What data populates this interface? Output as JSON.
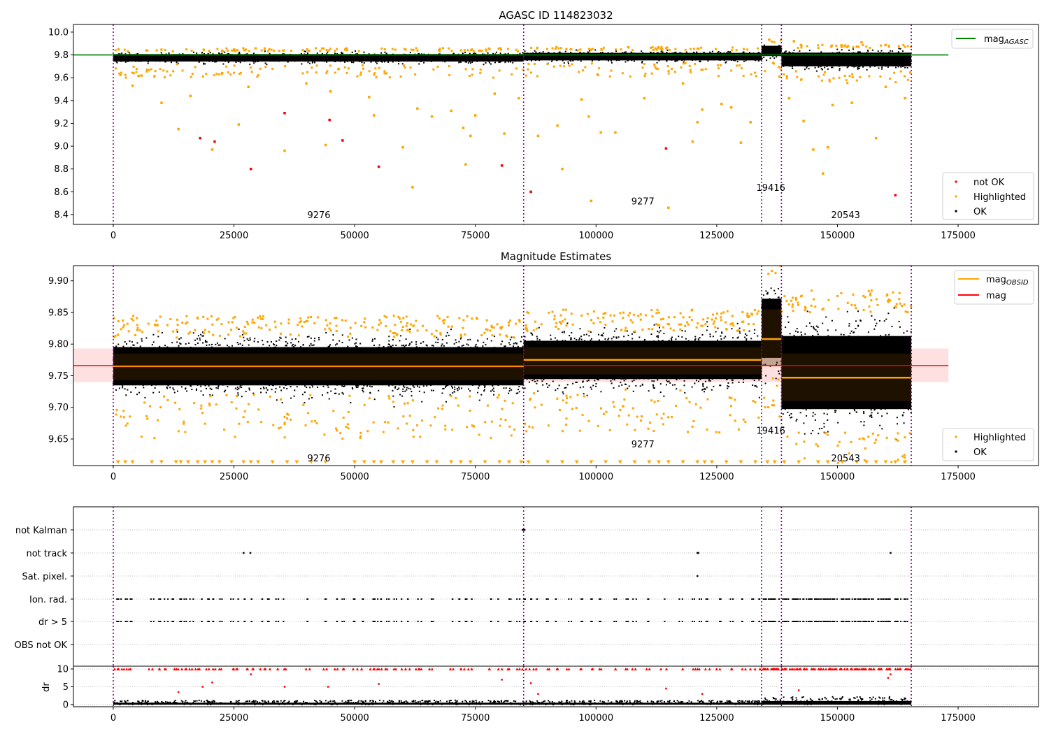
{
  "chart_data": [
    {
      "type": "scatter",
      "title": "AGASC ID 114823032",
      "xlim": [
        -8250,
        191650
      ],
      "ylim": [
        8.314,
        10.067
      ],
      "xticks": [
        0,
        25000,
        50000,
        75000,
        100000,
        125000,
        150000,
        175000
      ],
      "yticks": [
        8.4,
        8.6,
        8.8,
        9.0,
        9.2,
        9.4,
        9.6,
        9.8,
        10.0
      ],
      "ytick_labels": [
        "8.4",
        "8.6",
        "8.8",
        "9.0",
        "9.2",
        "9.4",
        "9.6",
        "9.8",
        "10.0"
      ],
      "mag_agasc": 9.8,
      "mag_agasc_xrange": [
        -8250,
        173000
      ],
      "legend_upper": [
        {
          "label": "mag",
          "sub": "AGASC",
          "color": "#008000"
        }
      ],
      "legend_lower": [
        {
          "label": "not OK",
          "color": "#ff0000"
        },
        {
          "label": "Highlighted",
          "color": "#ffa500"
        },
        {
          "label": "OK",
          "color": "#000000"
        }
      ],
      "obs_labels": [
        {
          "text": "9276",
          "x": 42600,
          "y": 8.4
        },
        {
          "text": "9277",
          "x": 109700,
          "y": 8.52
        },
        {
          "text": "19416",
          "x": 136200,
          "y": 8.64
        },
        {
          "text": "20543",
          "x": 151700,
          "y": 8.4
        }
      ],
      "ok_clouds": [
        {
          "x0": 0,
          "x1": 85000,
          "lo": 9.72,
          "hi": 9.83
        },
        {
          "x0": 85000,
          "x1": 134300,
          "lo": 9.73,
          "hi": 9.84
        },
        {
          "x0": 134300,
          "x1": 138400,
          "lo": 9.76,
          "hi": 9.91
        },
        {
          "x0": 138400,
          "x1": 165300,
          "lo": 9.66,
          "hi": 9.86
        }
      ],
      "not_ok": [
        [
          18000,
          9.07
        ],
        [
          21000,
          9.04
        ],
        [
          28500,
          8.8
        ],
        [
          35500,
          9.29
        ],
        [
          44800,
          9.23
        ],
        [
          47500,
          9.05
        ],
        [
          55000,
          8.82
        ],
        [
          80500,
          8.83
        ],
        [
          86500,
          8.6
        ],
        [
          114500,
          8.98
        ],
        [
          162000,
          8.57
        ]
      ],
      "highlighted": [
        [
          4000,
          9.53
        ],
        [
          10000,
          9.38
        ],
        [
          13500,
          9.15
        ],
        [
          16000,
          9.44
        ],
        [
          20500,
          8.97
        ],
        [
          26000,
          9.19
        ],
        [
          28000,
          9.52
        ],
        [
          35500,
          8.96
        ],
        [
          40000,
          9.55
        ],
        [
          44000,
          9.01
        ],
        [
          45000,
          9.48
        ],
        [
          53000,
          9.43
        ],
        [
          54000,
          9.27
        ],
        [
          60000,
          8.99
        ],
        [
          62000,
          8.64
        ],
        [
          63000,
          9.33
        ],
        [
          66000,
          9.26
        ],
        [
          70000,
          9.31
        ],
        [
          72500,
          9.16
        ],
        [
          73000,
          8.84
        ],
        [
          74000,
          9.09
        ],
        [
          75000,
          9.27
        ],
        [
          79000,
          9.46
        ],
        [
          81000,
          9.11
        ],
        [
          84000,
          9.42
        ],
        [
          88000,
          9.09
        ],
        [
          92000,
          9.18
        ],
        [
          93000,
          8.8
        ],
        [
          97000,
          9.41
        ],
        [
          98500,
          9.26
        ],
        [
          99000,
          8.52
        ],
        [
          101000,
          9.12
        ],
        [
          104000,
          9.12
        ],
        [
          110000,
          9.42
        ],
        [
          115000,
          8.46
        ],
        [
          118000,
          9.55
        ],
        [
          120000,
          9.04
        ],
        [
          121000,
          9.21
        ],
        [
          122000,
          9.32
        ],
        [
          126000,
          9.37
        ],
        [
          128000,
          9.34
        ],
        [
          130000,
          9.03
        ],
        [
          132000,
          9.21
        ],
        [
          138000,
          9.61
        ],
        [
          140000,
          9.42
        ],
        [
          143000,
          9.22
        ],
        [
          145000,
          8.97
        ],
        [
          147000,
          8.76
        ],
        [
          148000,
          8.99
        ],
        [
          149000,
          9.36
        ],
        [
          153000,
          9.38
        ],
        [
          158000,
          9.07
        ],
        [
          160000,
          9.52
        ],
        [
          164000,
          9.42
        ],
        [
          141000,
          9.92
        ],
        [
          155000,
          9.91
        ]
      ]
    },
    {
      "type": "scatter",
      "title": "Magnitude Estimates",
      "xlim": [
        -8250,
        191650
      ],
      "ylim": [
        9.608,
        9.924
      ],
      "xticks": [
        0,
        25000,
        50000,
        75000,
        100000,
        125000,
        150000,
        175000
      ],
      "yticks": [
        9.65,
        9.7,
        9.75,
        9.8,
        9.85,
        9.9
      ],
      "ytick_labels": [
        "9.65",
        "9.70",
        "9.75",
        "9.80",
        "9.85",
        "9.90"
      ],
      "mag": 9.766,
      "mag_band": [
        9.74,
        9.793
      ],
      "mag_xrange": [
        -8250,
        173000
      ],
      "legend_upper": [
        {
          "label": "mag",
          "sub": "OBSID",
          "color": "#ffa500"
        },
        {
          "label": "mag",
          "sub": "",
          "color": "#ff0000"
        }
      ],
      "legend_lower": [
        {
          "label": "Highlighted",
          "color": "#ffa500"
        },
        {
          "label": "OK",
          "color": "#000000"
        }
      ],
      "obs_labels": [
        {
          "text": "9276",
          "x": 42600,
          "y": 9.62
        },
        {
          "text": "9277",
          "x": 109700,
          "y": 9.642
        },
        {
          "text": "19416",
          "x": 136200,
          "y": 9.664
        },
        {
          "text": "20543",
          "x": 151700,
          "y": 9.62
        }
      ],
      "observations": [
        {
          "obsid": "9276",
          "x0": 0,
          "x1": 85000,
          "mag_obsid": 9.765,
          "std_band": [
            9.743,
            9.785
          ],
          "lo": 9.71,
          "hi": 9.82
        },
        {
          "obsid": "9277",
          "x0": 85000,
          "x1": 134300,
          "mag_obsid": 9.775,
          "std_band": [
            9.752,
            9.795
          ],
          "lo": 9.72,
          "hi": 9.83
        },
        {
          "obsid": "19416",
          "x0": 134300,
          "x1": 138400,
          "mag_obsid": 9.808,
          "std_band": [
            9.765,
            9.855
          ],
          "lo": 9.74,
          "hi": 9.91
        },
        {
          "obsid": "20543",
          "x0": 138400,
          "x1": 165300,
          "mag_obsid": 9.747,
          "std_band": [
            9.71,
            9.785
          ],
          "lo": 9.65,
          "hi": 9.86
        }
      ],
      "below_range_markers_x": [
        1000,
        2500,
        4000,
        8000,
        10000,
        13000,
        14000,
        15500,
        17500,
        19000,
        20500,
        22000,
        24500,
        27000,
        28500,
        30000,
        33000,
        36000,
        38000,
        41000,
        44000,
        50000,
        52000,
        54000,
        55500,
        58000,
        60000,
        62000,
        65000,
        67000,
        70000,
        72000,
        74000,
        77000,
        80000,
        82000,
        84500,
        86000,
        90000,
        93000,
        96000,
        99000,
        102000,
        105000,
        108000,
        111000,
        113000,
        115000,
        118000,
        121000,
        122500,
        124000,
        127000,
        130000,
        133000,
        135500,
        137000,
        139000,
        142000,
        146000,
        148000,
        151000,
        154000,
        156000,
        158000,
        160000,
        162000,
        164000
      ]
    },
    {
      "type": "scatter",
      "categories": [
        "not Kalman",
        "not track",
        "Sat. pixel.",
        "Ion. rad.",
        "dr > 5",
        "OBS not OK"
      ],
      "flags": {
        "not Kalman": [
          84800,
          85000,
          85200
        ],
        "not track": [
          27000,
          28400,
          121000,
          121200,
          161000
        ],
        "Sat. pixel.": [
          121000
        ],
        "Ion. rad.": "shared_with_dr5",
        "OBS not OK": []
      },
      "flag_events_x": [
        500,
        1500,
        2500,
        3500,
        8000,
        9500,
        11000,
        12500,
        13500,
        14500,
        15500,
        16500,
        18000,
        19500,
        21000,
        22500,
        24500,
        26000,
        27500,
        28500,
        31000,
        32000,
        34000,
        35500,
        40500,
        44000,
        46000,
        47500,
        50000,
        51500,
        53500,
        54500,
        55500,
        57000,
        58500,
        60000,
        61000,
        63000,
        64000,
        66000,
        70000,
        71500,
        73000,
        74500,
        78000,
        80000,
        82000,
        84000,
        85000,
        86500,
        88000,
        90000,
        92000,
        94500,
        97000,
        99000,
        101000,
        104000,
        106500,
        108000,
        111000,
        114000,
        117500,
        120000,
        121500,
        123000,
        125500,
        128000,
        130500,
        132500,
        134500,
        135500,
        136500,
        137500,
        139000,
        140500,
        142000,
        143500,
        145000,
        146500,
        148000,
        149500,
        151000,
        152500,
        154000,
        155500,
        157000,
        159000,
        160500,
        162500,
        164500
      ]
    },
    {
      "type": "scatter",
      "ylabel": "dr",
      "ylim": [
        -0.6,
        10.78
      ],
      "yticks": [
        0,
        5,
        10
      ],
      "ytick_labels": [
        "0",
        "5",
        "10"
      ],
      "xticks": [
        0,
        25000,
        50000,
        75000,
        100000,
        125000,
        150000,
        175000
      ],
      "clipped_value": 10,
      "red_points": [
        [
          13500,
          3.5
        ],
        [
          18500,
          5.0
        ],
        [
          20500,
          6.2
        ],
        [
          28500,
          8.5
        ],
        [
          35500,
          5.0
        ],
        [
          44500,
          5.0
        ],
        [
          55000,
          5.8
        ],
        [
          80500,
          7.0
        ],
        [
          86500,
          6.0
        ],
        [
          88000,
          3.0
        ],
        [
          114500,
          4.5
        ],
        [
          122000,
          3.0
        ],
        [
          142000,
          4.0
        ],
        [
          160500,
          7.5
        ],
        [
          161000,
          8.5
        ]
      ],
      "ok_band": [
        {
          "x0": 0,
          "x1": 134300,
          "hi": 1.2
        },
        {
          "x0": 134300,
          "x1": 165300,
          "hi": 2.2
        }
      ]
    }
  ],
  "obs_boundaries": [
    0,
    85000,
    134300,
    138400,
    165300
  ],
  "colors": {
    "ok": "#000000",
    "highlighted": "#ffa500",
    "not_ok": "#ff0000",
    "agasc": "#008000",
    "boundary": "#800080",
    "band": "#ffcccc"
  }
}
